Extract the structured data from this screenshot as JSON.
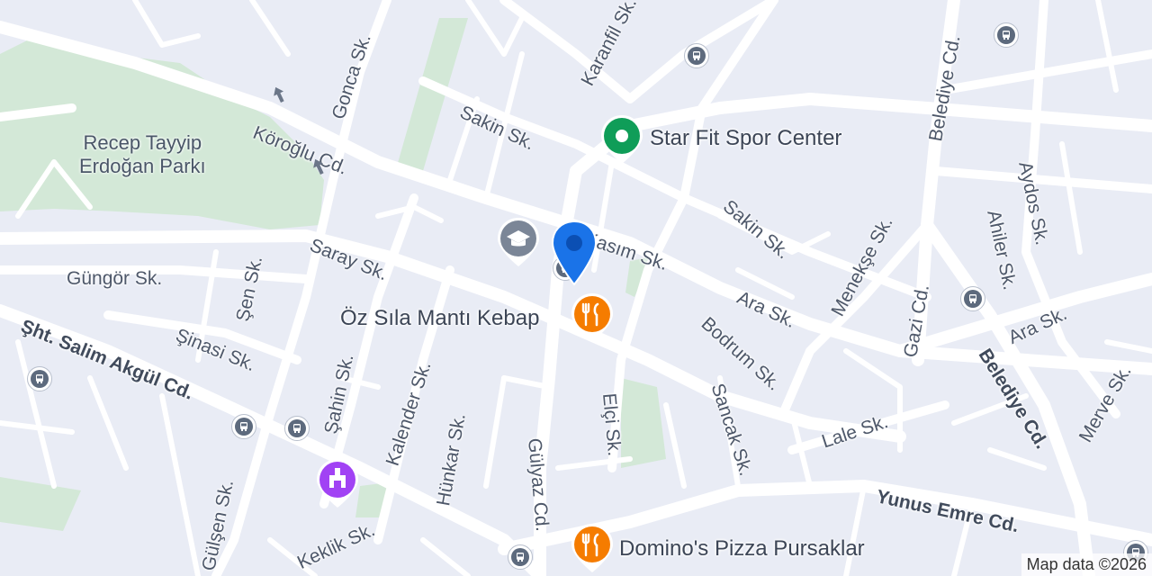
{
  "map": {
    "attribution": "Map data ©2026",
    "park_label_line1": "Recep Tayyip",
    "park_label_line2": "Erdoğan Parkı",
    "streets": {
      "karanfil": "Karanfil Sk.",
      "gonca": "Gonca Sk.",
      "sakin1": "Sakin Sk.",
      "koroglu": "Köroğlu Cd.",
      "belediye_top": "Belediye Cd.",
      "aydos": "Aydos Sk.",
      "ahiler": "Ahiler Sk.",
      "sakin2": "Sakin Sk.",
      "menekse": "Menekşe Sk.",
      "saray": "Saray Sk.",
      "kasim": "Kasım Sk.",
      "gungor": "Güngör Sk.",
      "sen": "Şen Sk.",
      "sinasi": "Şinasi Sk.",
      "salim": "Şht. Salim Akgül Cd.",
      "sahin": "Şahin Sk.",
      "kalender": "Kalender Sk.",
      "hunkar": "Hünkar Sk.",
      "gulyaz": "Gülyaz Cd.",
      "elci": "Elçi Sk.",
      "sancak": "Sancak Sk.",
      "bodrum": "Bodrum Sk.",
      "ara1": "Ara Sk.",
      "ara2": "Ara Sk.",
      "gazi": "Gazi Cd.",
      "belediye_right": "Belediye Cd.",
      "merve": "Merve Sk.",
      "lale": "Lale Sk.",
      "yunus": "Yunus Emre Cd.",
      "gulsen": "Gülşen Sk.",
      "keklik": "Keklik Sk."
    },
    "pois": {
      "starfit": "Star Fit Spor Center",
      "ozsila": "Öz Sıla Mantı Kebap",
      "dominos": "Domino's Pizza Pursaklar"
    },
    "colors": {
      "background": "#e9ecf5",
      "park": "#d3e8d7",
      "location_pin": "#1a73e8",
      "restaurant": "#f57c00",
      "gym": "#0f9d58",
      "school": "#7b8697",
      "landmark": "#a142f4"
    }
  }
}
